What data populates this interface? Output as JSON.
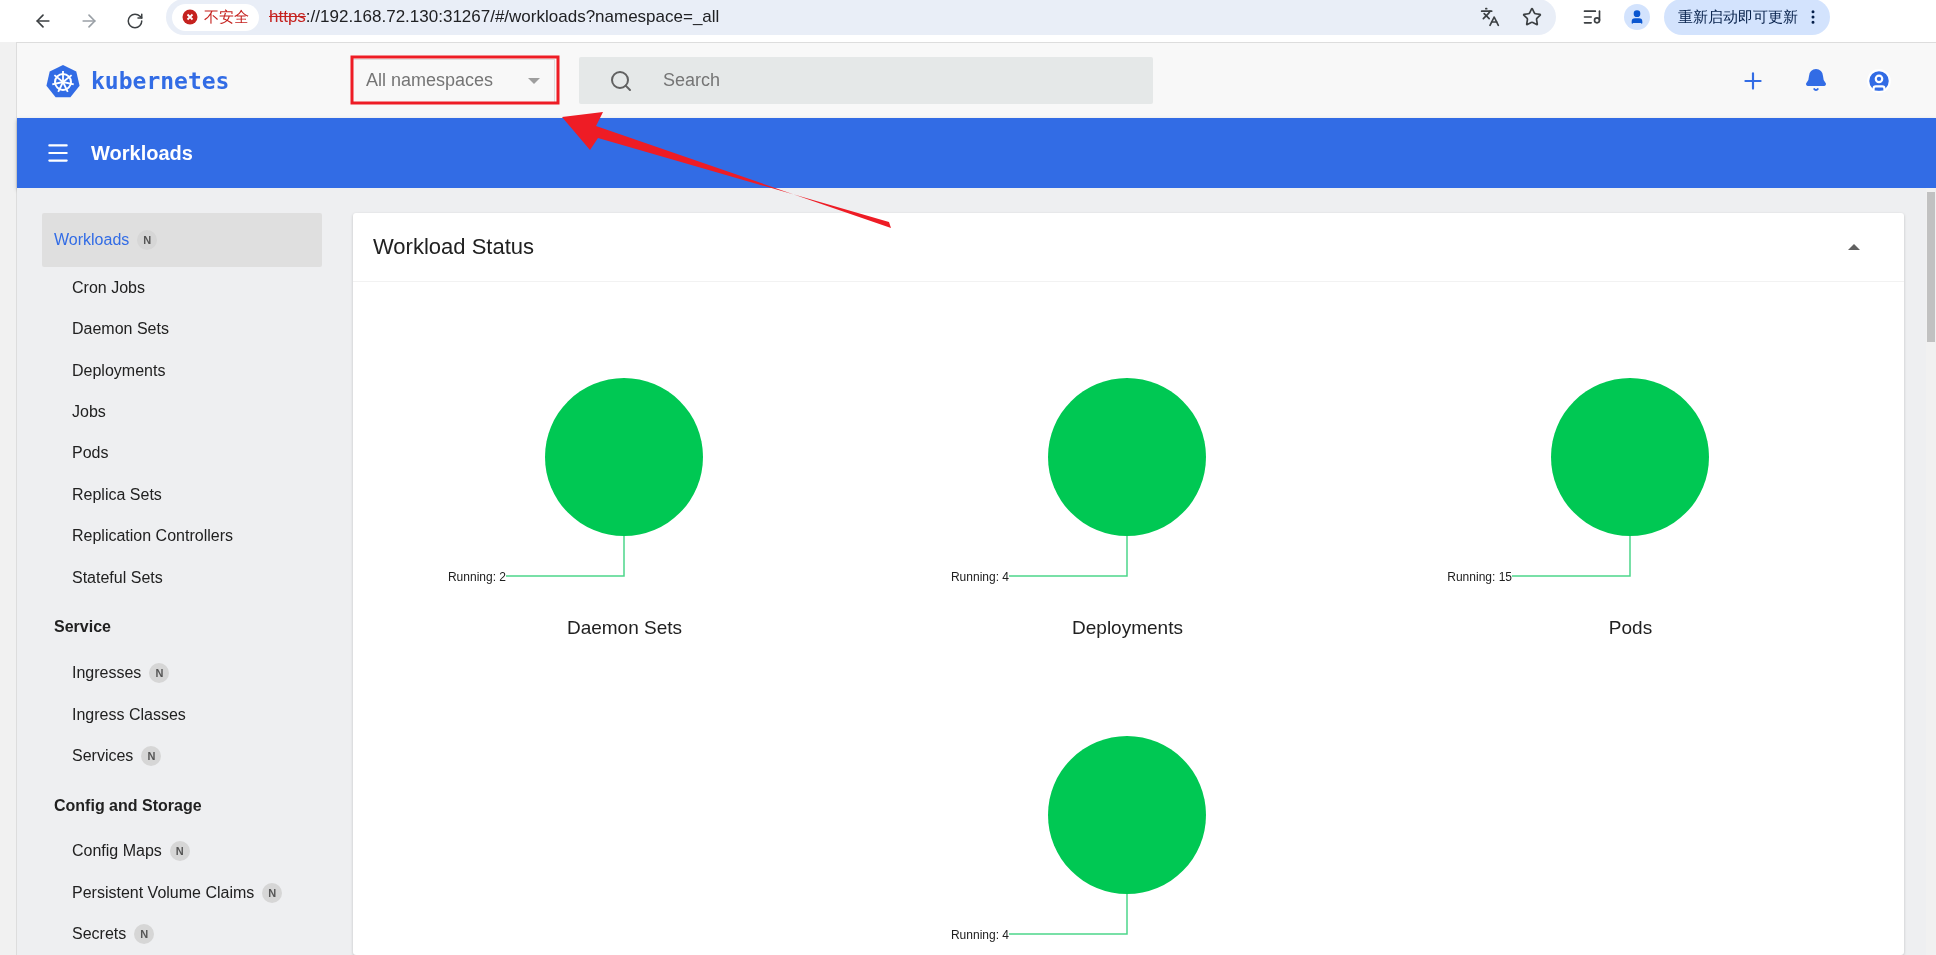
{
  "browser": {
    "security_label": "不安全",
    "url_scheme": "https",
    "url_rest": "://192.168.72.130:31267/#/workloads?namespace=_all",
    "update_button": "重新启动即可更新"
  },
  "header": {
    "logo_text": "kubernetes",
    "namespace_select": {
      "value": "All namespaces"
    },
    "search": {
      "placeholder": "Search"
    }
  },
  "title_bar": {
    "title": "Workloads"
  },
  "sidebar": [
    {
      "heading": {
        "label": "Workloads",
        "selected": true,
        "badge": "N",
        "kind": "link"
      },
      "items": [
        {
          "label": "Cron Jobs",
          "selected": false
        },
        {
          "label": "Daemon Sets",
          "selected": false
        },
        {
          "label": "Deployments",
          "selected": false
        },
        {
          "label": "Jobs",
          "selected": false
        },
        {
          "label": "Pods",
          "selected": false
        },
        {
          "label": "Replica Sets",
          "selected": false
        },
        {
          "label": "Replication Controllers",
          "selected": false
        },
        {
          "label": "Stateful Sets",
          "selected": false
        }
      ]
    },
    {
      "heading": {
        "label": "Service",
        "selected": false,
        "kind": "heading"
      },
      "items": [
        {
          "label": "Ingresses",
          "selected": false,
          "badge": "N"
        },
        {
          "label": "Ingress Classes",
          "selected": false
        },
        {
          "label": "Services",
          "selected": false,
          "badge": "N"
        }
      ]
    },
    {
      "heading": {
        "label": "Config and Storage",
        "selected": false,
        "kind": "heading"
      },
      "items": [
        {
          "label": "Config Maps",
          "selected": false,
          "badge": "N"
        },
        {
          "label": "Persistent Volume Claims",
          "selected": false,
          "badge": "N"
        },
        {
          "label": "Secrets",
          "selected": false,
          "badge": "N"
        }
      ]
    }
  ],
  "workload_status": {
    "title": "Workload Status",
    "expanded": true,
    "charts": [
      {
        "chart_data": {
          "type": "pie",
          "title": "Daemon Sets",
          "categories": [
            "Running: 2"
          ],
          "series": [
            {
              "color": "#00c853",
              "values": [
                100
              ]
            }
          ]
        }
      },
      {
        "chart_data": {
          "type": "pie",
          "title": "Deployments",
          "categories": [
            "Running: 4"
          ],
          "series": [
            {
              "color": "#00c853",
              "values": [
                100
              ]
            }
          ]
        }
      },
      {
        "chart_data": {
          "type": "pie",
          "title": "Pods",
          "categories": [
            "Running: 15"
          ],
          "series": [
            {
              "color": "#00c853",
              "values": [
                100
              ]
            }
          ]
        }
      },
      {
        "chart_data": {
          "type": "pie",
          "categories": [
            "Running: 4"
          ],
          "series": [
            {
              "color": "#00c853",
              "values": [
                100
              ]
            }
          ]
        }
      }
    ]
  }
}
